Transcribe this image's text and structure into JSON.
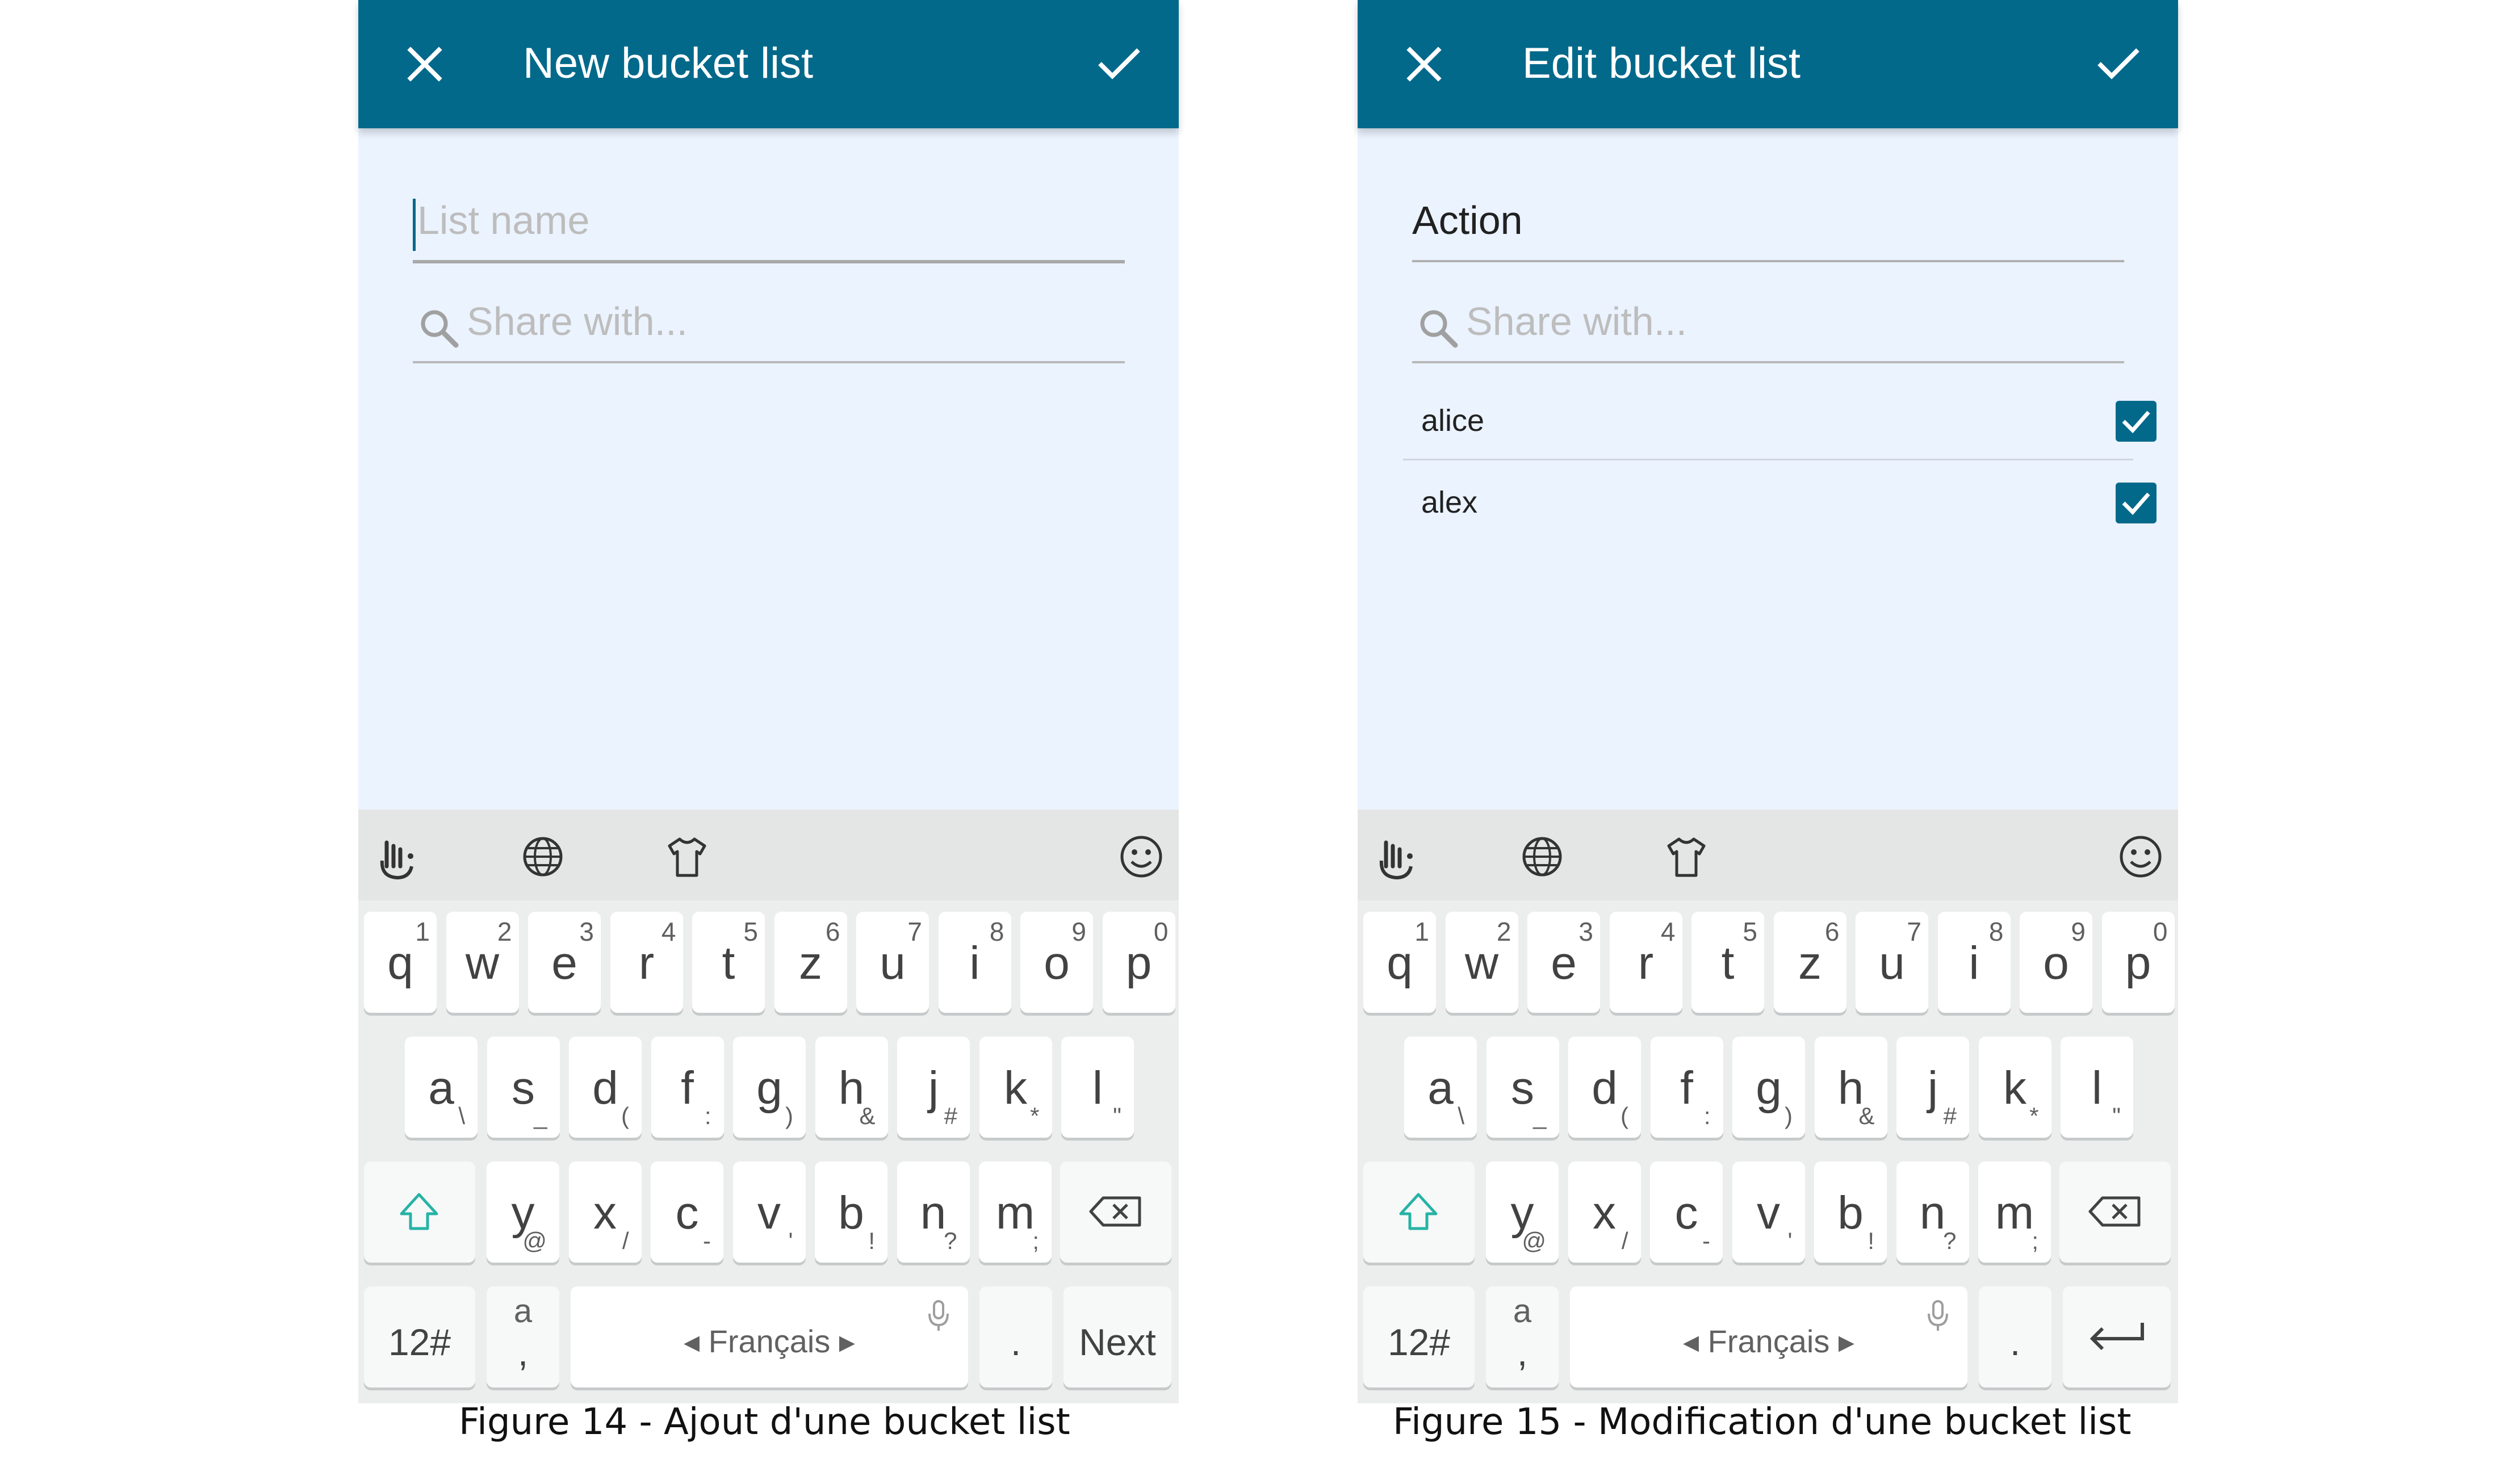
{
  "screens": [
    {
      "title": "New bucket list",
      "list_name": {
        "value": "",
        "placeholder": "List name"
      },
      "share": {
        "placeholder": "Share with..."
      },
      "users": [],
      "keyboard": {
        "language": "Français",
        "action_key": "Next"
      }
    },
    {
      "title": "Edit bucket list",
      "list_name": {
        "value": "Action",
        "placeholder": "List name"
      },
      "share": {
        "placeholder": "Share with..."
      },
      "users": [
        {
          "name": "alice",
          "checked": true
        },
        {
          "name": "alex",
          "checked": true
        }
      ],
      "keyboard": {
        "language": "Français",
        "action_key": "enter-icon"
      }
    }
  ],
  "keyboard_layout": {
    "row1": [
      {
        "k": "q",
        "n": "1"
      },
      {
        "k": "w",
        "n": "2"
      },
      {
        "k": "e",
        "n": "3"
      },
      {
        "k": "r",
        "n": "4"
      },
      {
        "k": "t",
        "n": "5"
      },
      {
        "k": "z",
        "n": "6"
      },
      {
        "k": "u",
        "n": "7"
      },
      {
        "k": "i",
        "n": "8"
      },
      {
        "k": "o",
        "n": "9"
      },
      {
        "k": "p",
        "n": "0"
      }
    ],
    "row2": [
      {
        "k": "a",
        "s": "\\"
      },
      {
        "k": "s",
        "s": "_"
      },
      {
        "k": "d",
        "s": "("
      },
      {
        "k": "f",
        "s": ":"
      },
      {
        "k": "g",
        "s": ")"
      },
      {
        "k": "h",
        "s": "&"
      },
      {
        "k": "j",
        "s": "#"
      },
      {
        "k": "k",
        "s": "*"
      },
      {
        "k": "l",
        "s": "\""
      }
    ],
    "row3": [
      {
        "k": "y",
        "s": "@"
      },
      {
        "k": "x",
        "s": "/"
      },
      {
        "k": "c",
        "s": "-"
      },
      {
        "k": "v",
        "s": "'"
      },
      {
        "k": "b",
        "s": "!"
      },
      {
        "k": "n",
        "s": "?"
      },
      {
        "k": "m",
        "s": ";"
      }
    ],
    "numbers_key": "12#",
    "accent_key_top": "a",
    "accent_key_bottom": ",",
    "period_key": "."
  },
  "captions": [
    "Figure 14 - Ajout d'une bucket list",
    "Figure 15 - Modification d'une bucket list"
  ],
  "colors": {
    "appbar": "#03698b",
    "background": "#ebf3ff",
    "shift_accent": "#26b3a6"
  },
  "icons": [
    "close-icon",
    "check-icon",
    "search-icon",
    "swipe-hand-icon",
    "globe-icon",
    "tshirt-icon",
    "smiley-icon",
    "shift-icon",
    "backspace-icon",
    "microphone-icon",
    "enter-icon"
  ]
}
